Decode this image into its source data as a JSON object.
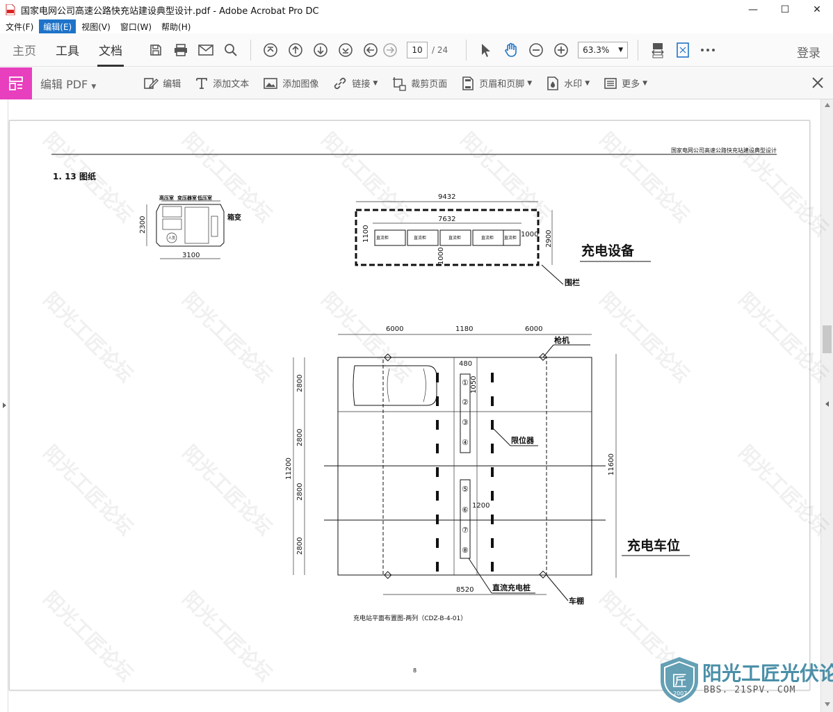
{
  "window": {
    "title": "国家电网公司高速公路快充站建设典型设计.pdf - Adobe Acrobat Pro DC"
  },
  "menubar": {
    "items": [
      "文件(F)",
      "编辑(E)",
      "视图(V)",
      "窗口(W)",
      "帮助(H)"
    ]
  },
  "toolbar": {
    "tabs": [
      "主页",
      "工具",
      "文档"
    ],
    "page_current": "10",
    "page_total": "/ 24",
    "zoom": "63.3%",
    "login": "登录"
  },
  "edit_toolbar": {
    "title": "编辑 PDF",
    "tools": [
      "编辑",
      "添加文本",
      "添加图像",
      "链接",
      "裁剪页面",
      "页眉和页脚",
      "水印",
      "更多"
    ]
  },
  "document": {
    "header_text": "国家电网公司高速公路快充站建设典型设计",
    "section_title": "1. 13 图纸",
    "box_transformer": {
      "labels": [
        "高压室",
        "变压器室",
        "低压室"
      ],
      "dim_w": "3100",
      "dim_h": "2300",
      "side_label": "箱变",
      "bottom_label": "人员"
    },
    "charging_equipment": {
      "outer_width": "9432",
      "inner_width": "7632",
      "height": "2900",
      "inner_h": "1100",
      "gap": "1000",
      "gap_right": "1000",
      "label": "充电设备",
      "fence_label": "围栏"
    },
    "parking": {
      "top_dims": [
        "6000",
        "1180",
        "6000"
      ],
      "left_dims": [
        "2800",
        "2800",
        "2800",
        "2800"
      ],
      "total_left": "11200",
      "total_right": "11600",
      "bottom_dim": "8520",
      "small_dims": [
        "480",
        "1050",
        "1200"
      ],
      "chargers": [
        "①",
        "②",
        "③",
        "④",
        "⑤",
        "⑥",
        "⑦",
        "⑧"
      ],
      "labels": {
        "gun": "枪机",
        "limiter": "限位器",
        "dc_pile": "直流充电桩",
        "shed": "车棚",
        "title": "充电车位"
      }
    },
    "caption": "充电站平面布置图-两列（CDZ-B-4-01）",
    "page_number": "8"
  },
  "watermark": {
    "text": "阳光工匠论坛",
    "brand": "阳光工匠光伏论坛",
    "url": "BBS. 21SPV. COM",
    "year": "2007"
  }
}
